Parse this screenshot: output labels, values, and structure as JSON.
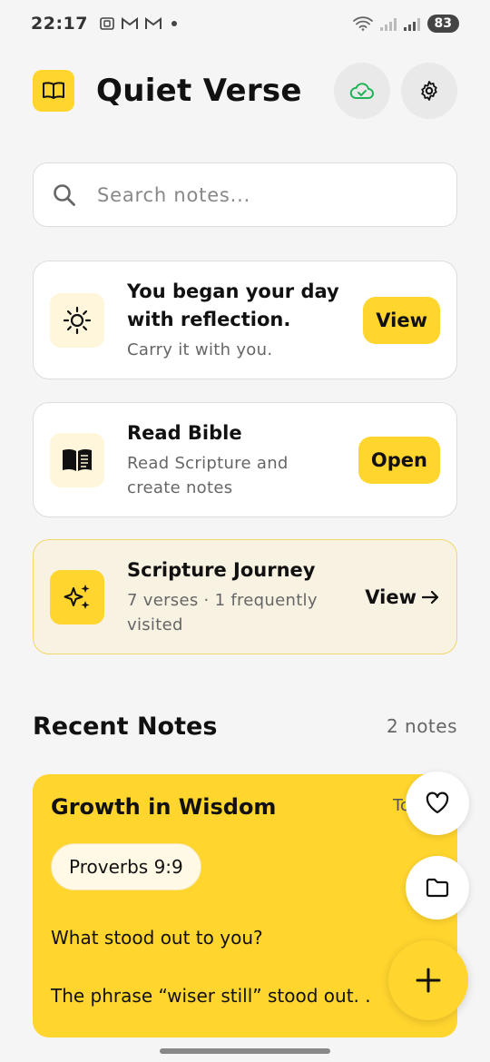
{
  "status": {
    "time": "22:17",
    "battery": "83"
  },
  "header": {
    "title": "Quiet Verse"
  },
  "search": {
    "placeholder": "Search notes..."
  },
  "cards": {
    "reflection": {
      "title": "You began your day with reflection.",
      "subtitle": "Carry it with you.",
      "action": "View"
    },
    "bible": {
      "title": "Read Bible",
      "subtitle": "Read Scripture and create notes",
      "action": "Open"
    },
    "journey": {
      "title": "Scripture Journey",
      "subtitle": "7 verses · 1 frequently visited",
      "action": "View"
    }
  },
  "recent": {
    "title": "Recent Notes",
    "count": "2 notes"
  },
  "note": {
    "title": "Growth in Wisdom",
    "date": "To",
    "verse": "Proverbs 9:9",
    "question": "What stood out to you?",
    "answer": "The phrase “wiser still” stood out. ."
  },
  "colors": {
    "accent": "#ffd52e",
    "background": "#f5f5f5",
    "sync": "#22b35a"
  }
}
